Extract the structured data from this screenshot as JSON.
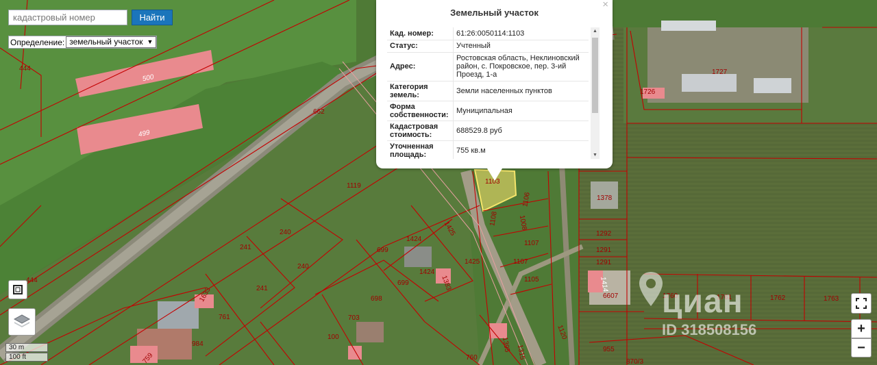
{
  "search": {
    "placeholder": "кадастровый номер",
    "button": "Найти"
  },
  "definition": {
    "label": "Определение:",
    "selected": "земельный участок"
  },
  "popup": {
    "title": "Земельный участок",
    "close": "×",
    "rows": [
      {
        "key": "Кад. номер:",
        "value": "61:26:0050114:1103"
      },
      {
        "key": "Статус:",
        "value": "Учтенный"
      },
      {
        "key": "Адрес:",
        "value": "Ростовская область, Неклиновский район, с. Покровское, пер. 3-ий Проезд, 1-а"
      },
      {
        "key": "Категория земель:",
        "value": "Земли населенных пунктов"
      },
      {
        "key": "Форма собственности:",
        "value": "Муниципальная"
      },
      {
        "key": "Кадастровая стоимость:",
        "value": "688529.8 руб"
      },
      {
        "key": "Уточненная площадь:",
        "value": "755 кв.м"
      }
    ]
  },
  "scale": {
    "metric": "30 m",
    "imperial": "100 ft"
  },
  "zoom": {
    "in": "+",
    "out": "−"
  },
  "watermark": {
    "brand": "циан",
    "id": "ID 318508156"
  },
  "parcels": [
    "444",
    "500",
    "499",
    "662",
    "1119",
    "240",
    "241",
    "240",
    "241",
    "444",
    "699",
    "1424",
    "1425",
    "699",
    "1424",
    "1383",
    "1425",
    "698",
    "703",
    "100",
    "984",
    "761",
    "1633",
    "759",
    "1103",
    "1106",
    "1108",
    "1008",
    "1107",
    "1107",
    "1105",
    "1120",
    "1395",
    "1315",
    "760",
    "1378",
    "1292",
    "1291",
    "1291",
    "1414",
    "6607",
    "1760",
    "1761",
    "1762",
    "1763",
    "955",
    "870/3",
    "1727",
    "1726"
  ],
  "colors": {
    "parcel_line": "#c40000",
    "building_fill": "#e98a8e",
    "selected_fill": "#f0dc6a",
    "button_blue": "#1b75bb"
  }
}
